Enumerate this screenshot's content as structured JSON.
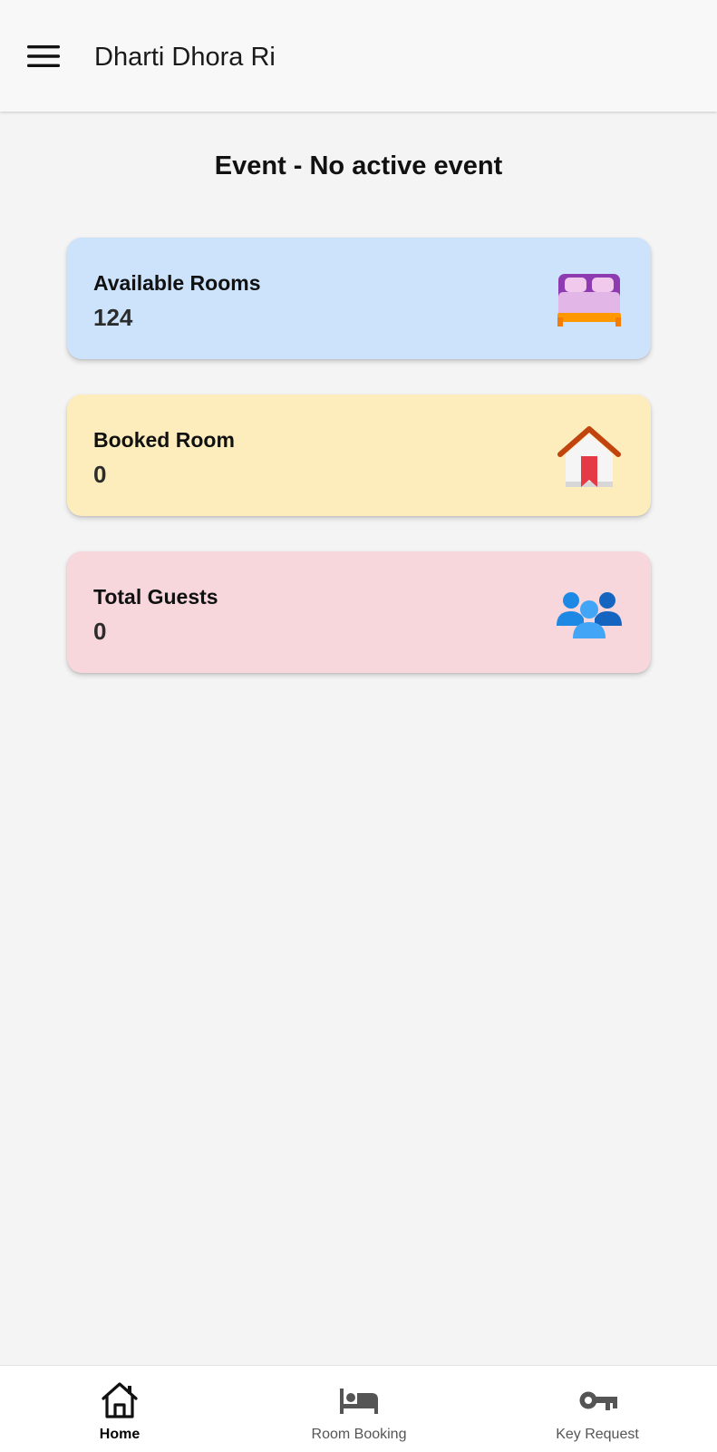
{
  "app_bar": {
    "title": "Dharti Dhora Ri",
    "menu_icon": "hamburger-menu-icon"
  },
  "event": {
    "title": "Event - No active event"
  },
  "cards": [
    {
      "label": "Available Rooms",
      "value": "124",
      "icon": "bed-icon",
      "background": "#cce3fb"
    },
    {
      "label": "Booked Room",
      "value": "0",
      "icon": "house-bookmark-icon",
      "background": "#feedbc"
    },
    {
      "label": "Total Guests",
      "value": "0",
      "icon": "people-group-icon",
      "background": "#f7d7dc"
    }
  ],
  "bottom_nav": {
    "items": [
      {
        "label": "Home",
        "icon": "home-icon",
        "active": true
      },
      {
        "label": "Room Booking",
        "icon": "bed-icon",
        "active": false
      },
      {
        "label": "Key Request",
        "icon": "key-icon",
        "active": false
      }
    ]
  }
}
